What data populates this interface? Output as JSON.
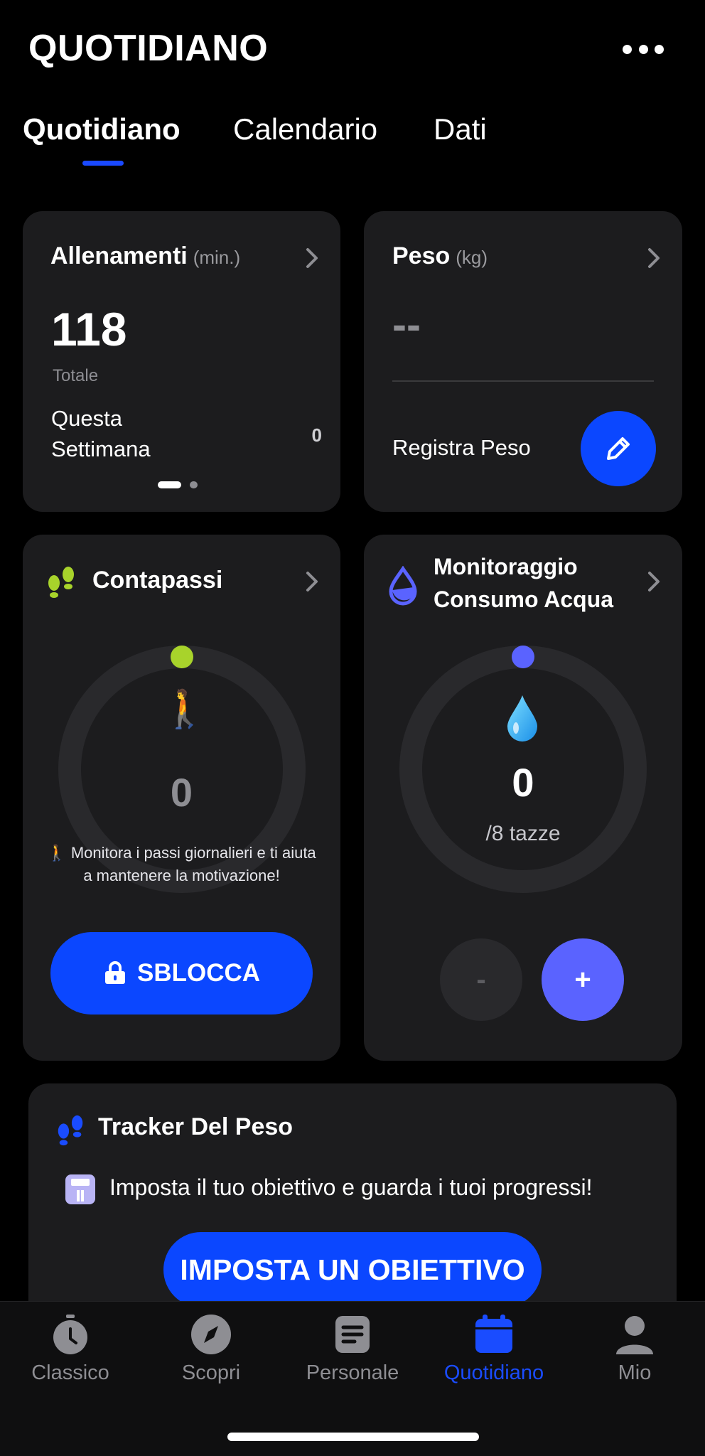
{
  "header": {
    "title": "QUOTIDIANO"
  },
  "tabs": [
    "Quotidiano",
    "Calendario",
    "Dati"
  ],
  "workouts": {
    "title": "Allenamenti",
    "unit": "(min.)",
    "total_value": "118",
    "total_label": "Totale",
    "week_label_line1": "Questa",
    "week_label_line2": "Settimana",
    "week_value": "0"
  },
  "weight": {
    "title": "Peso",
    "unit": "(kg)",
    "value": "--",
    "log_label": "Registra Peso"
  },
  "steps": {
    "title": "Contapassi",
    "value": "0",
    "hint": "🚶 Monitora i passi giornalieri e ti aiuta a mantenere la motivazione!",
    "unlock_label": "SBLOCCA",
    "accent": "#a8d32b"
  },
  "water": {
    "title_line1": "Monitoraggio",
    "title_line2": "Consumo Acqua",
    "value": "0",
    "goal": "/8 tazze",
    "minus_label": "-",
    "plus_label": "+",
    "accent": "#5a63ff"
  },
  "tracker": {
    "title": "Tracker Del Peso",
    "desc": "Imposta il tuo obiettivo e guarda i tuoi progressi!",
    "cta": "IMPOSTA UN OBIETTIVO"
  },
  "nav": {
    "items": [
      "Classico",
      "Scopri",
      "Personale",
      "Quotidiano",
      "Mio"
    ],
    "active": "Quotidiano",
    "active_color": "#1a4cff"
  }
}
